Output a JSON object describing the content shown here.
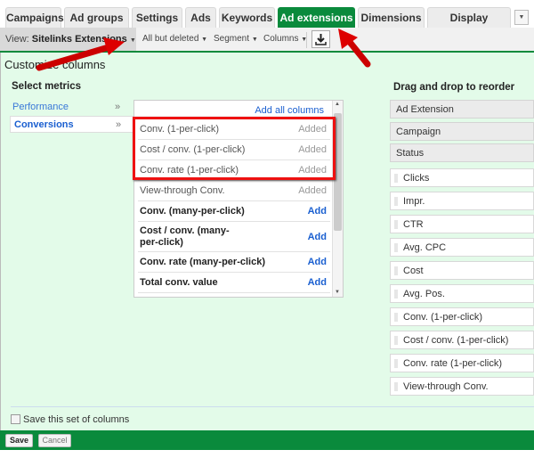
{
  "tabs": [
    "Campaigns",
    "Ad groups",
    "Settings",
    "Ads",
    "Keywords",
    "Ad extensions",
    "Dimensions",
    "Display Network"
  ],
  "active_tab": "Ad extensions",
  "toolbar": {
    "view_label": "View:",
    "view_value": "Sitelinks Extensions",
    "filter": "All but deleted",
    "segment": "Segment",
    "columns": "Columns"
  },
  "panel": {
    "title": "Customize columns",
    "select_heading": "Select metrics",
    "categories": [
      "Performance",
      "Conversions"
    ],
    "add_all": "Add all columns",
    "metrics": [
      {
        "label": "Conv. (1-per-click)",
        "action": "Added"
      },
      {
        "label": "Cost / conv. (1-per-click)",
        "action": "Added"
      },
      {
        "label": "Conv. rate (1-per-click)",
        "action": "Added"
      },
      {
        "label": "View-through Conv.",
        "action": "Added"
      },
      {
        "label": "Conv. (many-per-click)",
        "action": "Add"
      },
      {
        "label": "Cost / conv. (many-per-click)",
        "action": "Add"
      },
      {
        "label": "Conv. rate (many-per-click)",
        "action": "Add"
      },
      {
        "label": "Total conv. value",
        "action": "Add"
      }
    ],
    "reorder_heading": "Drag and drop to reorder",
    "fixed_columns": [
      "Ad Extension",
      "Campaign",
      "Status"
    ],
    "columns": [
      "Clicks",
      "Impr.",
      "CTR",
      "Avg. CPC",
      "Cost",
      "Avg. Pos.",
      "Conv. (1-per-click)",
      "Cost / conv. (1-per-click)",
      "Conv. rate (1-per-click)",
      "View-through Conv."
    ],
    "save_set": "Save this set of columns"
  },
  "footer": {
    "save": "Save",
    "cancel": "Cancel"
  }
}
